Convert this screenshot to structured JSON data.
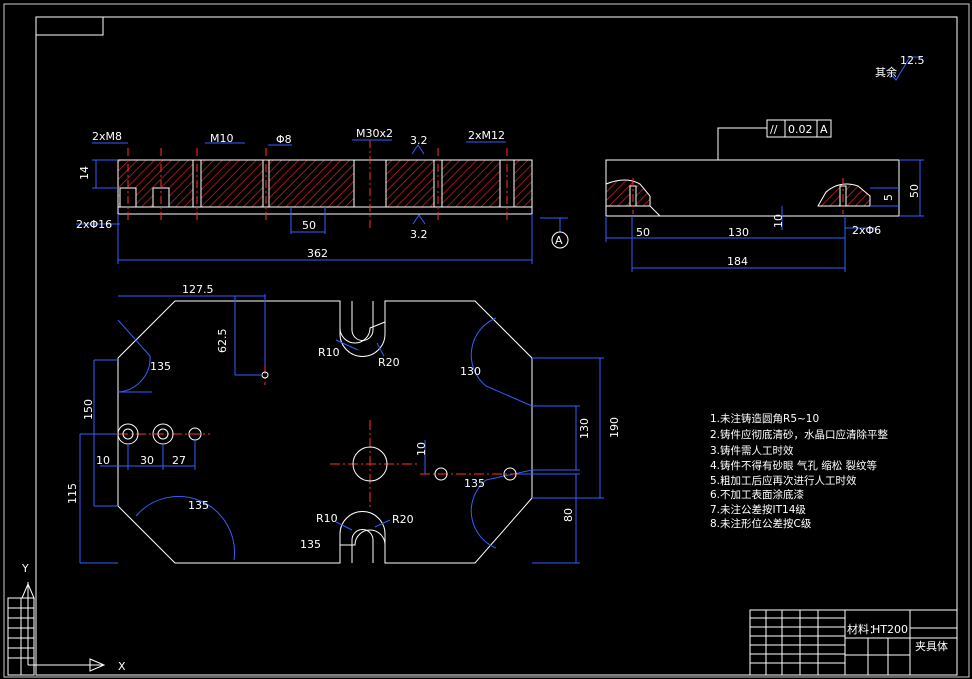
{
  "colors": {
    "background": "#000000",
    "frame": "#ffffff",
    "outline": "#ffffff",
    "dimension": "#3060ff",
    "hatch": "#c02020",
    "center": "#ff3030",
    "text": "#ffffff"
  },
  "roughness": {
    "value": "12.5",
    "label": "其余"
  },
  "tolerance_frame": {
    "symbol": "//",
    "value": "0.02",
    "datum": "A"
  },
  "datum_label": "A",
  "section_view": {
    "labels": [
      "2xM8",
      "M10",
      "Φ8",
      "M30x2",
      "3.2",
      "2xM12",
      "14",
      "2xΦ16",
      "50",
      "3.2",
      "362"
    ]
  },
  "side_view": {
    "labels": [
      "5",
      "50",
      "50",
      "130",
      "10",
      "2xΦ6",
      "184"
    ]
  },
  "plan_view": {
    "labels": [
      "127.5",
      "62.5",
      "R10",
      "R20",
      "135",
      "130",
      "130",
      "190",
      "150",
      "10",
      "30",
      "27",
      "115",
      "135",
      "10",
      "135",
      "80",
      "R10",
      "R20",
      "135"
    ]
  },
  "notes": [
    "1.未注铸造圆角R5~10",
    "2.铸件应彻底清砂，水晶口应清除平整",
    "3.铸件需人工时效",
    "4.铸件不得有砂眼 气孔 缩松 裂纹等",
    "5.粗加工后应再次进行人工时效",
    "6.不加工表面涂底漆",
    "7.未注公差按IT14级",
    "8.未注形位公差按C级"
  ],
  "title_block": {
    "material_label": "材料：",
    "material": "HT200",
    "part_name": "夹具体"
  },
  "ucs": {
    "y": "Y",
    "x": "X"
  }
}
